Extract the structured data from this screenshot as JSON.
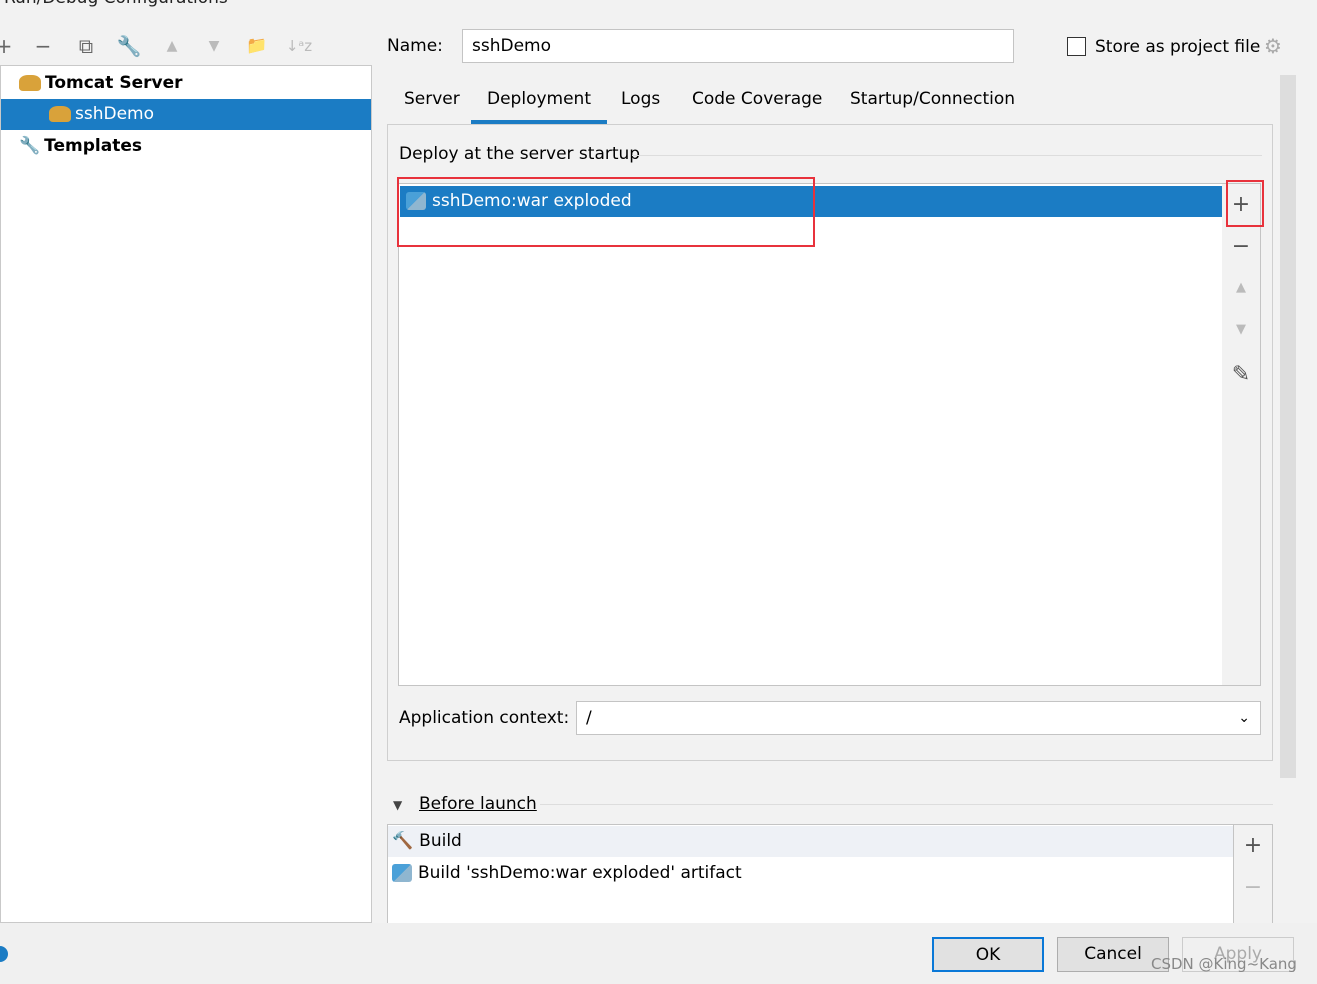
{
  "window": {
    "title": "Run/Debug Configurations"
  },
  "toolbar": {
    "add": "+",
    "remove": "−",
    "copy": "⧉",
    "edit": "🔧",
    "up": "▲",
    "down": "▼",
    "folder": "📁",
    "sort": "↓ᵃz"
  },
  "tree": {
    "items": [
      {
        "label": "Tomcat Server",
        "icon": "tomcat-icon"
      },
      {
        "label": "sshDemo",
        "icon": "tomcat-icon",
        "selected": true
      },
      {
        "label": "Templates",
        "icon": "wrench-icon"
      }
    ]
  },
  "name": {
    "label": "Name:",
    "value": "sshDemo"
  },
  "store": {
    "label": "Store as project file",
    "checked": false
  },
  "tabs": [
    {
      "label": "Server"
    },
    {
      "label": "Deployment",
      "active": true
    },
    {
      "label": "Logs"
    },
    {
      "label": "Code Coverage"
    },
    {
      "label": "Startup/Connection"
    }
  ],
  "deploy": {
    "legend": "Deploy at the server startup",
    "items": [
      "sshDemo:war exploded"
    ]
  },
  "context": {
    "label": "Application context:",
    "value": "/"
  },
  "before": {
    "label": "Before launch",
    "items": [
      "Build",
      "Build 'sshDemo:war exploded' artifact"
    ]
  },
  "buttons": {
    "ok": "OK",
    "cancel": "Cancel",
    "apply": "Apply"
  },
  "watermark": "CSDN @King~Kang",
  "colors": {
    "accent": "#1b7cc4",
    "highlight": "#e8323c"
  }
}
